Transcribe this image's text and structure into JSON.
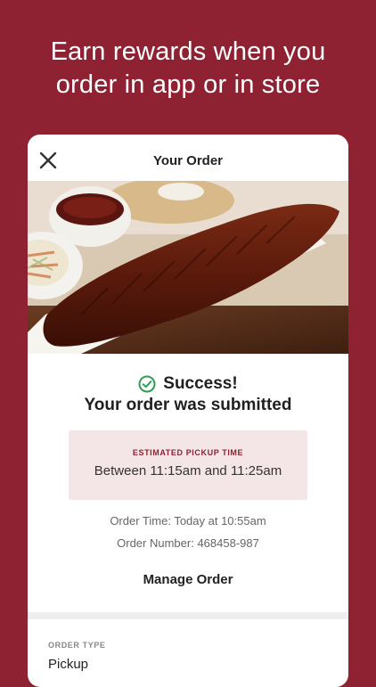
{
  "promo": {
    "line1": "Earn rewards when you",
    "line2": "order in app or in store"
  },
  "header": {
    "title": "Your Order",
    "close_icon": "close-icon"
  },
  "success": {
    "title": "Success!",
    "subtitle": "Your order was submitted",
    "icon": "check-circle-icon"
  },
  "pickup": {
    "label": "ESTIMATED PICKUP TIME",
    "time": "Between 11:15am and 11:25am"
  },
  "order": {
    "time": "Order Time: Today at 10:55am",
    "number": "Order Number: 468458-987",
    "manage_label": "Manage Order",
    "type_label": "ORDER TYPE",
    "type_value": "Pickup"
  },
  "colors": {
    "brand": "#8e2132",
    "success": "#2e9e55"
  }
}
